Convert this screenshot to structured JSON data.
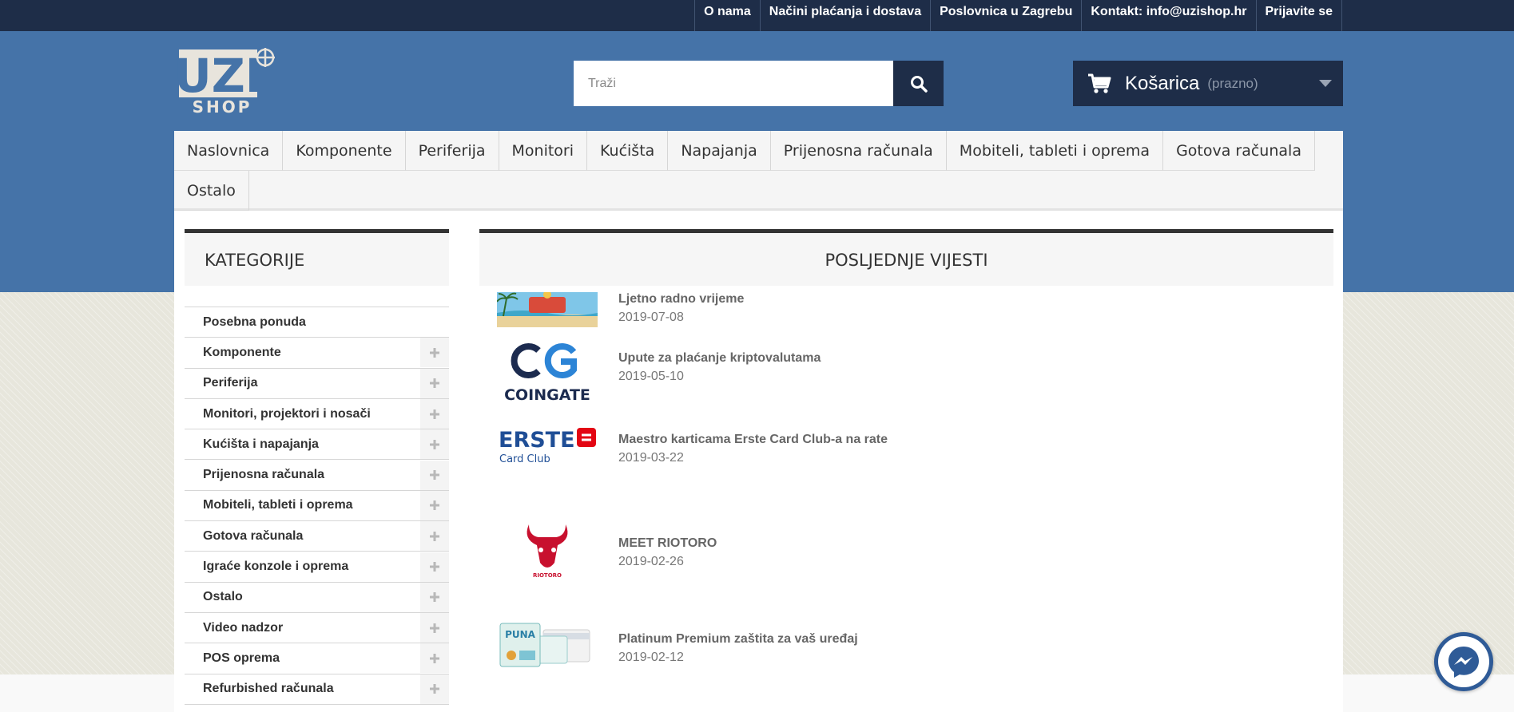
{
  "top_nav": [
    "O nama",
    "Načini plaćanja i dostava",
    "Poslovnica u Zagrebu",
    "Kontakt: info@uzishop.hr",
    "Prijavite se"
  ],
  "logo": {
    "top": "UZI",
    "bottom": "SHOP"
  },
  "search": {
    "placeholder": "Traži"
  },
  "cart": {
    "label": "Košarica",
    "status": "(prazno)"
  },
  "main_menu": [
    "Naslovnica",
    "Komponente",
    "Periferija",
    "Monitori",
    "Kućišta",
    "Napajanja",
    "Prijenosna računala",
    "Mobiteli, tableti i oprema",
    "Gotova računala",
    "Ostalo"
  ],
  "sidebar": {
    "title": "KATEGORIJE",
    "items": [
      {
        "label": "Posebna ponuda",
        "expandable": false
      },
      {
        "label": "Komponente",
        "expandable": true
      },
      {
        "label": "Periferija",
        "expandable": true
      },
      {
        "label": "Monitori, projektori i nosači",
        "expandable": true
      },
      {
        "label": "Kućišta i napajanja",
        "expandable": true
      },
      {
        "label": "Prijenosna računala",
        "expandable": true
      },
      {
        "label": "Mobiteli, tableti i oprema",
        "expandable": true
      },
      {
        "label": "Gotova računala",
        "expandable": true
      },
      {
        "label": "Igraće konzole i oprema",
        "expandable": true
      },
      {
        "label": "Ostalo",
        "expandable": true
      },
      {
        "label": "Video nadzor",
        "expandable": true
      },
      {
        "label": "POS oprema",
        "expandable": true
      },
      {
        "label": "Refurbished računala",
        "expandable": true
      }
    ]
  },
  "news": {
    "title": "POSLJEDNJE VIJESTI",
    "items": [
      {
        "title": "Ljetno radno vrijeme",
        "date": "2019-07-08",
        "thumb": "beach-banner"
      },
      {
        "title": "Upute za plaćanje kriptovalutama",
        "date": "2019-05-10",
        "thumb": "coingate-logo",
        "thumb_text": "COINGATE"
      },
      {
        "title": "Maestro karticama Erste Card Club-a na rate",
        "date": "2019-03-22",
        "thumb": "erste-logo",
        "thumb_text": "ERSTE",
        "thumb_sub": "Card Club"
      },
      {
        "title": "MEET RIOTORO",
        "date": "2019-02-26",
        "thumb": "riotoro-logo",
        "thumb_text": "RIOTORO"
      },
      {
        "title": "Platinum Premium zaštita za vaš uređaj",
        "date": "2019-02-12",
        "thumb": "puna-cards",
        "thumb_text": "PUNA"
      }
    ]
  },
  "colors": {
    "header_blue": "#4573a8",
    "navy": "#1e2d48",
    "erste_red": "#e30613",
    "riotoro_red": "#c8102e",
    "messenger_blue": "#2f5b97"
  }
}
